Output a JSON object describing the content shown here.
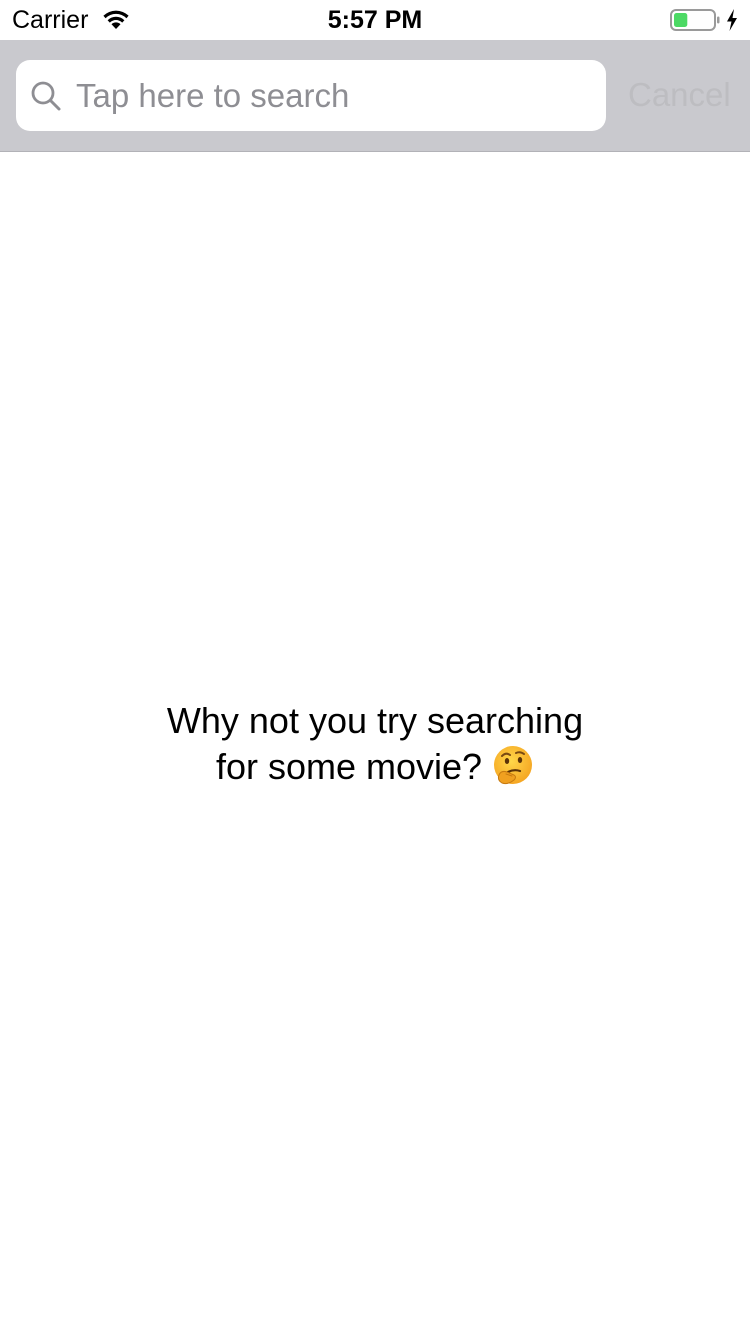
{
  "status_bar": {
    "carrier": "Carrier",
    "time": "5:57 PM",
    "battery_level": 0.35,
    "charging": true,
    "battery_color": "#4cd964"
  },
  "search": {
    "placeholder": "Tap here to search",
    "value": "",
    "cancel_label": "Cancel",
    "icon": "search-icon"
  },
  "empty_state": {
    "line1": "Why not you try searching",
    "line2": "for some movie?",
    "emoji_icon": "thinking-face-icon"
  }
}
